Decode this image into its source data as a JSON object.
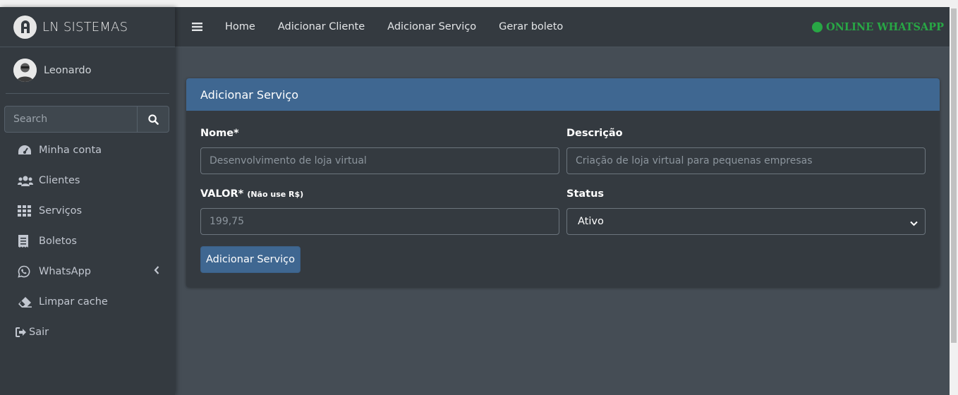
{
  "brand": {
    "name": "LN SISTEMAS",
    "logo_icon": "ln-logo-icon"
  },
  "user": {
    "name": "Leonardo",
    "avatar_icon": "avatar"
  },
  "search": {
    "placeholder": "Search",
    "icon": "search-icon"
  },
  "sidebar": {
    "items": [
      {
        "label": "Minha conta",
        "icon": "tachometer-icon"
      },
      {
        "label": "Clientes",
        "icon": "users-icon"
      },
      {
        "label": "Serviços",
        "icon": "grid-icon"
      },
      {
        "label": "Boletos",
        "icon": "receipt-icon"
      },
      {
        "label": "WhatsApp",
        "icon": "whatsapp-icon"
      },
      {
        "label": "Limpar cache",
        "icon": "eraser-icon"
      },
      {
        "label": "Sair",
        "icon": "sign-out-icon"
      }
    ]
  },
  "navbar": {
    "links": [
      "Home",
      "Adicionar Cliente",
      "Adicionar Serviço",
      "Gerar boleto"
    ],
    "status": "ONLINE WHATSAPP",
    "status_color": "#28a745"
  },
  "form": {
    "title": "Adicionar Serviço",
    "nome_label": "Nome*",
    "nome_placeholder": "Desenvolvimento de loja virtual",
    "descricao_label": "Descrição",
    "descricao_placeholder": "Criação de loja virtual para pequenas empresas",
    "valor_label": "VALOR*",
    "valor_hint": "(Não use R$)",
    "valor_placeholder": "199,75",
    "status_label": "Status",
    "status_value": "Ativo",
    "submit_label": "Adicionar Serviço"
  },
  "colors": {
    "accent": "#3f6791",
    "sidebar": "#343a40",
    "content_bg": "#454d55"
  }
}
